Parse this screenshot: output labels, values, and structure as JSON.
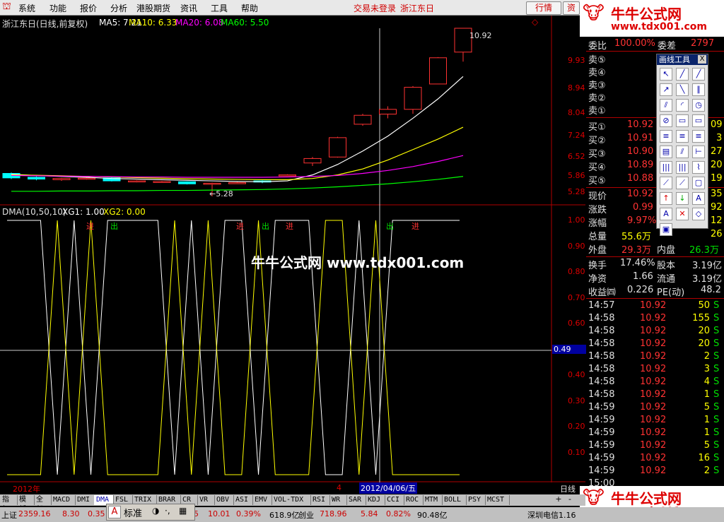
{
  "menu": {
    "logo": "⛫",
    "items": [
      "系统",
      "功能",
      "报价",
      "分析",
      "港股期货",
      "资讯",
      "工具",
      "帮助"
    ],
    "login_status": "交易未登录",
    "stock_name": "浙江东日",
    "btn_quote": "行情",
    "btn_info": "资"
  },
  "kline": {
    "title": "浙江东日(日线,前复权)",
    "ma5": "MA5: 7.21",
    "ma10": "MA10: 6.33",
    "ma20": "MA20: 6.08",
    "ma60": "MA60: 5.50",
    "high_label": "10.92",
    "low_label": "←5.28",
    "yticks": [
      "9.93",
      "8.94",
      "8.04",
      "7.24",
      "6.52",
      "5.86",
      "5.28"
    ],
    "diamond": "◇",
    "colors": {
      "ma5": "#ffffff",
      "ma10": "#ffff00",
      "ma20": "#ff00ff",
      "ma60": "#00ff00",
      "up": "#ff3232",
      "down": "#00ffff"
    }
  },
  "dma": {
    "title": "DMA(10,50,10)",
    "xg1": "XG1: 1.00",
    "xg2": "XG2: 0.00",
    "yticks": [
      "1.00",
      "0.90",
      "0.80",
      "0.70",
      "0.60",
      "0.49",
      "0.40",
      "0.30",
      "0.20",
      "0.10"
    ],
    "buy": "进",
    "sell": "出",
    "current": "0.49"
  },
  "xaxis": {
    "year": "2012年",
    "marker4": "4",
    "date": "2012/04/06/五",
    "period": "日线"
  },
  "watermark": {
    "center": "牛牛公式网 www.tdx001.com",
    "site_name": "牛牛公式网",
    "site_url": "www.tdx001.com"
  },
  "quote": {
    "weibi_label": "委比",
    "weibi_value": "100.00%",
    "weicha_label": "委差",
    "weicha_value": "2797",
    "sells": [
      {
        "label": "卖⑤",
        "price": "",
        "vol": ""
      },
      {
        "label": "卖④",
        "price": "",
        "vol": ""
      },
      {
        "label": "卖③",
        "price": "",
        "vol": ""
      },
      {
        "label": "卖②",
        "price": "",
        "vol": ""
      },
      {
        "label": "卖①",
        "price": "",
        "vol": ""
      }
    ],
    "buys": [
      {
        "label": "买①",
        "price": "10.92",
        "vol": "09"
      },
      {
        "label": "买②",
        "price": "10.91",
        "vol": "3"
      },
      {
        "label": "买③",
        "price": "10.90",
        "vol": "27"
      },
      {
        "label": "买④",
        "price": "10.89",
        "vol": "20"
      },
      {
        "label": "买⑤",
        "price": "10.88",
        "vol": "19"
      }
    ],
    "stats": [
      {
        "label": "现价",
        "value": "10.92",
        "extra": "35"
      },
      {
        "label": "涨跌",
        "value": "0.99",
        "extra": "92"
      },
      {
        "label": "涨幅",
        "value": "9.97%",
        "extra": "12"
      },
      {
        "label": "总量",
        "value": "55.6万",
        "extra": "26"
      }
    ],
    "waipan_label": "外盘",
    "waipan": "29.3万",
    "neipan_label": "内盘",
    "neipan": "26.3万",
    "huanshou_label": "换手",
    "huanshou": "17.46%",
    "guben_label": "股本",
    "guben": "3.19亿",
    "jingzi_label": "净资",
    "jingzi": "1.66",
    "liutong_label": "流通",
    "liutong": "3.19亿",
    "shouyi_label": "收益㈣",
    "shouyi": "0.226",
    "pe_label": "PE(动)",
    "pe": "48.2"
  },
  "ticks": [
    {
      "t": "14:57",
      "p": "10.92",
      "v": "50",
      "f": "S"
    },
    {
      "t": "14:58",
      "p": "10.92",
      "v": "155",
      "f": "S"
    },
    {
      "t": "14:58",
      "p": "10.92",
      "v": "20",
      "f": "S"
    },
    {
      "t": "14:58",
      "p": "10.92",
      "v": "20",
      "f": "S"
    },
    {
      "t": "14:58",
      "p": "10.92",
      "v": "2",
      "f": "S"
    },
    {
      "t": "14:58",
      "p": "10.92",
      "v": "3",
      "f": "S"
    },
    {
      "t": "14:58",
      "p": "10.92",
      "v": "4",
      "f": "S"
    },
    {
      "t": "14:58",
      "p": "10.92",
      "v": "1",
      "f": "S"
    },
    {
      "t": "14:59",
      "p": "10.92",
      "v": "5",
      "f": "S"
    },
    {
      "t": "14:59",
      "p": "10.92",
      "v": "1",
      "f": "S"
    },
    {
      "t": "14:59",
      "p": "10.92",
      "v": "1",
      "f": "S"
    },
    {
      "t": "14:59",
      "p": "10.92",
      "v": "5",
      "f": "S"
    },
    {
      "t": "14:59",
      "p": "10.92",
      "v": "16",
      "f": "S"
    },
    {
      "t": "14:59",
      "p": "10.92",
      "v": "2",
      "f": "S"
    },
    {
      "t": "15:00",
      "p": "",
      "v": "",
      "f": ""
    }
  ],
  "drawtools": {
    "title": "画线工具",
    "close": "X"
  },
  "tabs": [
    "指标",
    "模板",
    "全部",
    "MACD",
    "DMI",
    "DMA",
    "FSL",
    "TRIX",
    "BRAR",
    "CR",
    "VR",
    "OBV",
    "ASI",
    "EMV",
    "VOL-TDX",
    "RSI",
    "WR",
    "SAR",
    "KDJ",
    "CCI",
    "ROC",
    "MTM",
    "BOLL",
    "PSY",
    "MCST"
  ],
  "tab_arrows": [
    "+",
    "-"
  ],
  "ime": {
    "mode": "标准",
    "a": "A"
  },
  "status": {
    "sh_label": "上证",
    "sh_price": "2359.16",
    "sh_chg": "8.30",
    "sh_pct": "0.35",
    "cy_chg": "5",
    "cy_chg2": "10.01",
    "cy_pct": "0.39%",
    "cy_amt": "618.9亿",
    "cy_label": "创业",
    "cy_price": "718.96",
    "cy_c": "5.84",
    "cy_p": "0.82%",
    "cy_a": "90.48亿",
    "right": "深圳电信1.16"
  },
  "chart_data": {
    "type": "line",
    "candles": [
      {
        "o": 6.05,
        "c": 5.9,
        "h": 6.08,
        "l": 5.86
      },
      {
        "o": 5.92,
        "c": 5.86,
        "h": 5.95,
        "l": 5.82
      },
      {
        "o": 5.84,
        "c": 5.88,
        "h": 5.9,
        "l": 5.8
      },
      {
        "o": 5.86,
        "c": 5.89,
        "h": 5.92,
        "l": 5.84
      },
      {
        "o": 5.9,
        "c": 5.8,
        "h": 5.92,
        "l": 5.78
      },
      {
        "o": 5.78,
        "c": 5.8,
        "h": 5.82,
        "l": 5.75
      },
      {
        "o": 5.76,
        "c": 5.78,
        "h": 5.8,
        "l": 5.74
      },
      {
        "o": 5.77,
        "c": 5.7,
        "h": 5.78,
        "l": 5.68
      },
      {
        "o": 5.7,
        "c": 5.72,
        "h": 5.74,
        "l": 5.28
      },
      {
        "o": 5.72,
        "c": 5.74,
        "h": 5.76,
        "l": 5.7
      },
      {
        "o": 5.8,
        "c": 5.76,
        "h": 5.82,
        "l": 5.72
      },
      {
        "o": 6.0,
        "c": 6.0,
        "h": 6.02,
        "l": 5.98
      },
      {
        "o": 6.4,
        "c": 6.55,
        "h": 6.6,
        "l": 6.3
      },
      {
        "o": 6.6,
        "c": 7.25,
        "h": 7.28,
        "l": 6.58
      },
      {
        "o": 7.7,
        "c": 8.0,
        "h": 8.05,
        "l": 7.65
      },
      {
        "o": 8.04,
        "c": 8.2,
        "h": 8.3,
        "l": 7.9
      },
      {
        "o": 8.2,
        "c": 8.94,
        "h": 8.98,
        "l": 8.05
      },
      {
        "o": 9.05,
        "c": 9.93,
        "h": 9.95,
        "l": 9.05
      },
      {
        "o": 10.12,
        "c": 10.92,
        "h": 10.92,
        "l": 9.8
      }
    ],
    "ma5": [
      6.02,
      5.98,
      5.95,
      5.92,
      5.88,
      5.86,
      5.84,
      5.82,
      5.8,
      5.78,
      5.77,
      5.8,
      6.0,
      6.35,
      6.8,
      7.3,
      7.9,
      8.55,
      9.3
    ],
    "ma10": [
      6.0,
      5.99,
      5.97,
      5.95,
      5.93,
      5.91,
      5.89,
      5.87,
      5.86,
      5.85,
      5.84,
      5.84,
      5.88,
      6.0,
      6.2,
      6.5,
      6.85,
      7.2,
      7.6
    ],
    "ma20": [
      5.98,
      5.97,
      5.96,
      5.95,
      5.94,
      5.93,
      5.93,
      5.92,
      5.92,
      5.92,
      5.92,
      5.93,
      5.95,
      5.98,
      6.05,
      6.15,
      6.28,
      6.45,
      6.65
    ],
    "ma60": [
      5.45,
      5.45,
      5.46,
      5.46,
      5.47,
      5.47,
      5.48,
      5.48,
      5.49,
      5.5,
      5.51,
      5.53,
      5.56,
      5.6,
      5.65,
      5.7,
      5.77,
      5.85,
      5.95
    ],
    "ylim": [
      5.28,
      10.92
    ],
    "xg1": [
      1,
      1,
      1,
      0,
      1,
      0,
      1,
      1,
      1,
      1,
      0,
      1,
      0,
      1,
      1,
      0,
      1,
      1,
      1,
      0,
      0,
      1,
      0,
      1,
      1,
      1,
      1,
      1
    ],
    "dma_ylim": [
      0,
      1
    ]
  }
}
